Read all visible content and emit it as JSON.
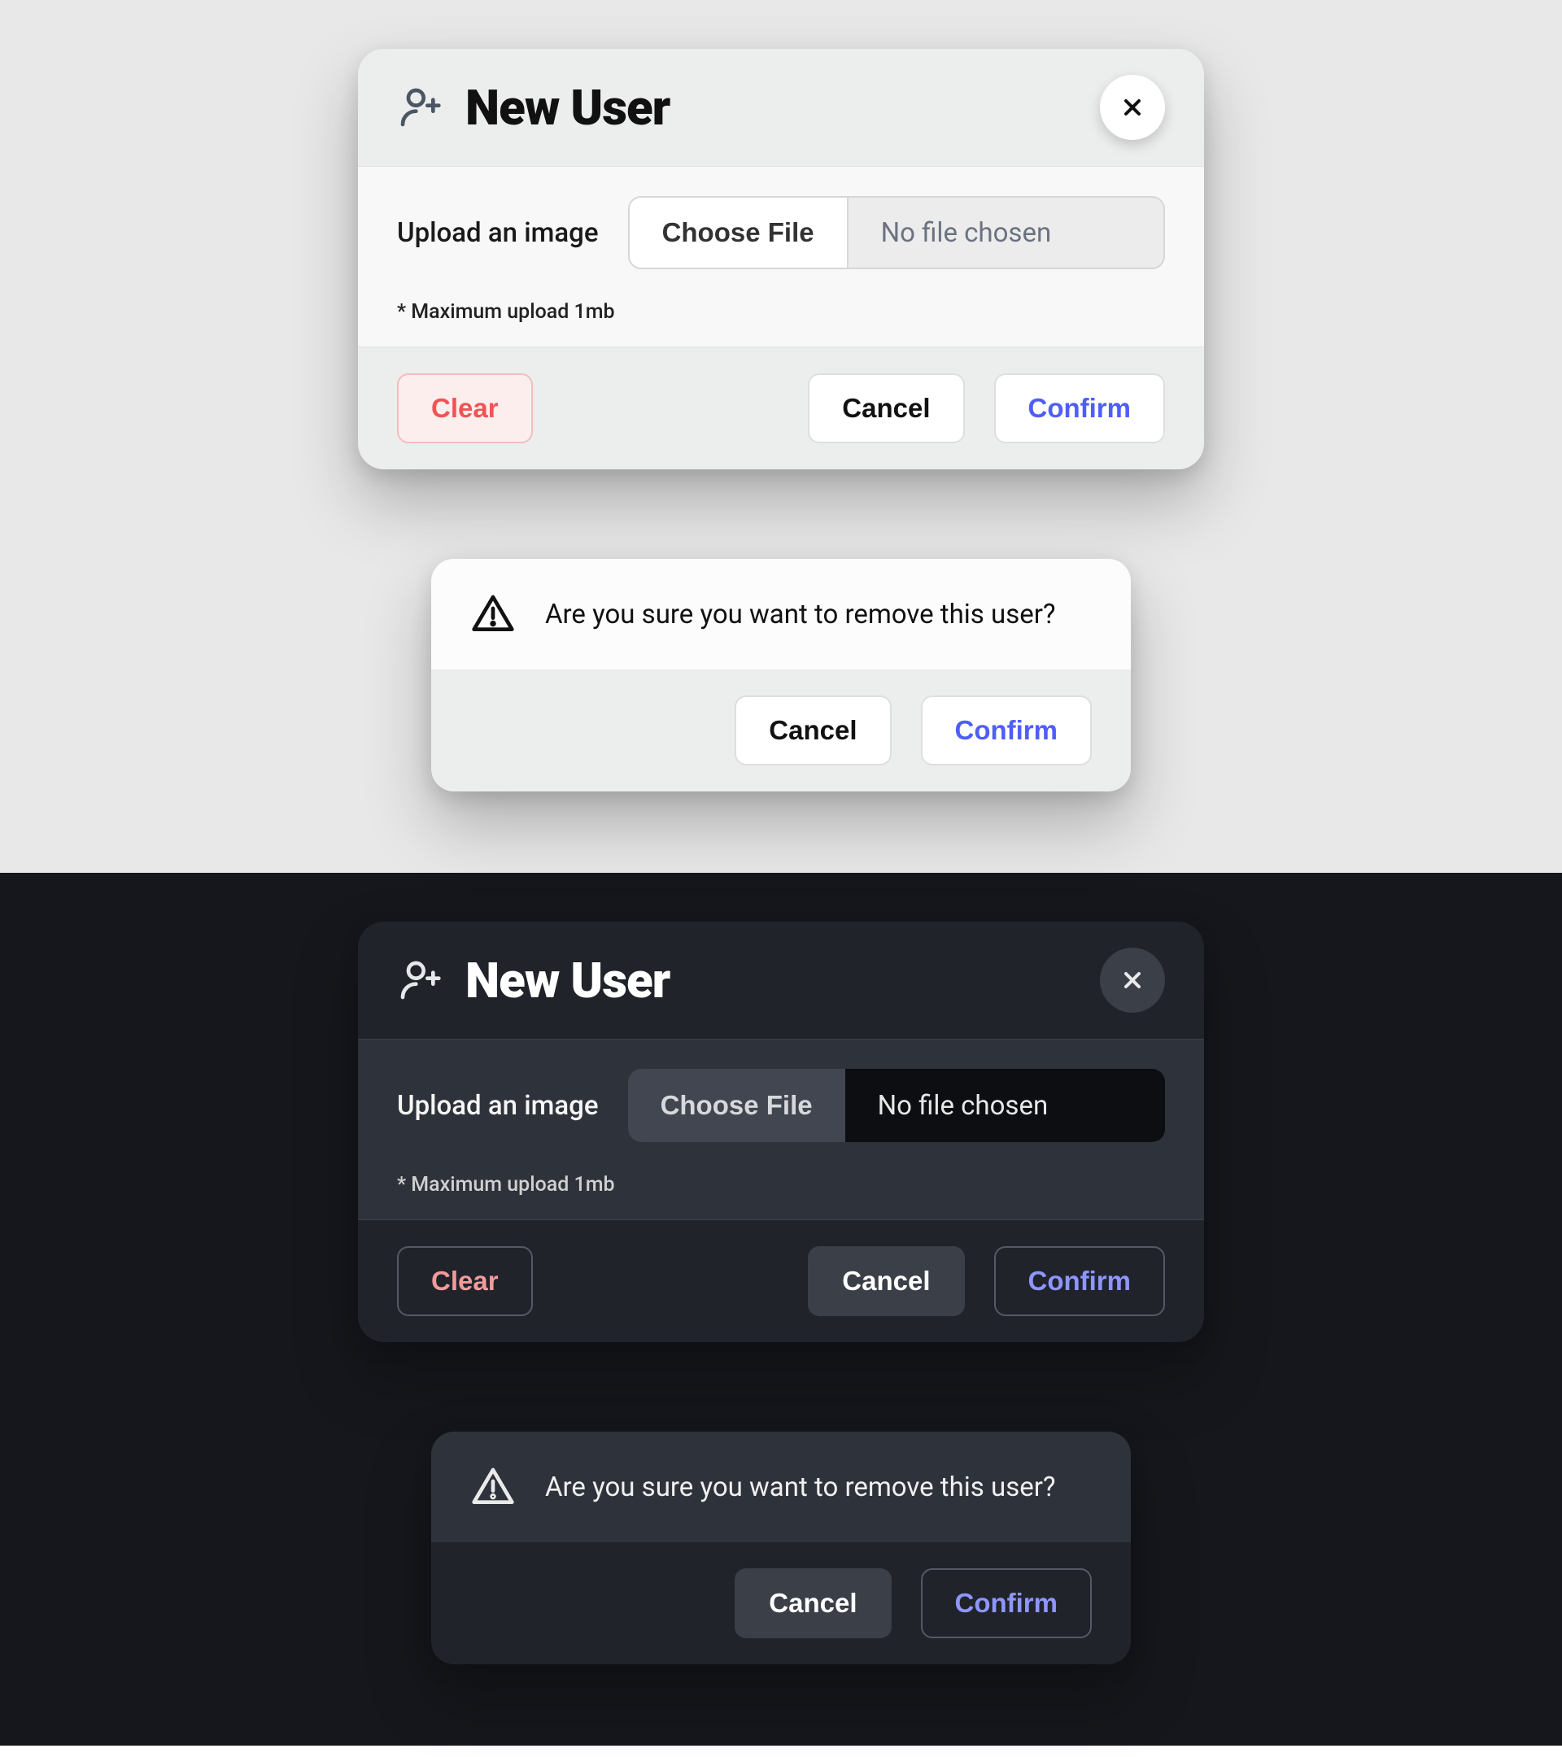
{
  "modal": {
    "title": "New User",
    "upload_label": "Upload an image",
    "file_button": "Choose File",
    "file_status": "No file chosen",
    "hint": "* Maximum upload 1mb",
    "clear": "Clear",
    "cancel": "Cancel",
    "confirm": "Confirm"
  },
  "alert": {
    "message": "Are you sure you want to remove this user?",
    "cancel": "Cancel",
    "confirm": "Confirm"
  },
  "colors": {
    "light_bg": "#e8e8e8",
    "dark_bg": "#15171c",
    "accent_blue": "#4f5ef7",
    "danger": "#f05454"
  }
}
